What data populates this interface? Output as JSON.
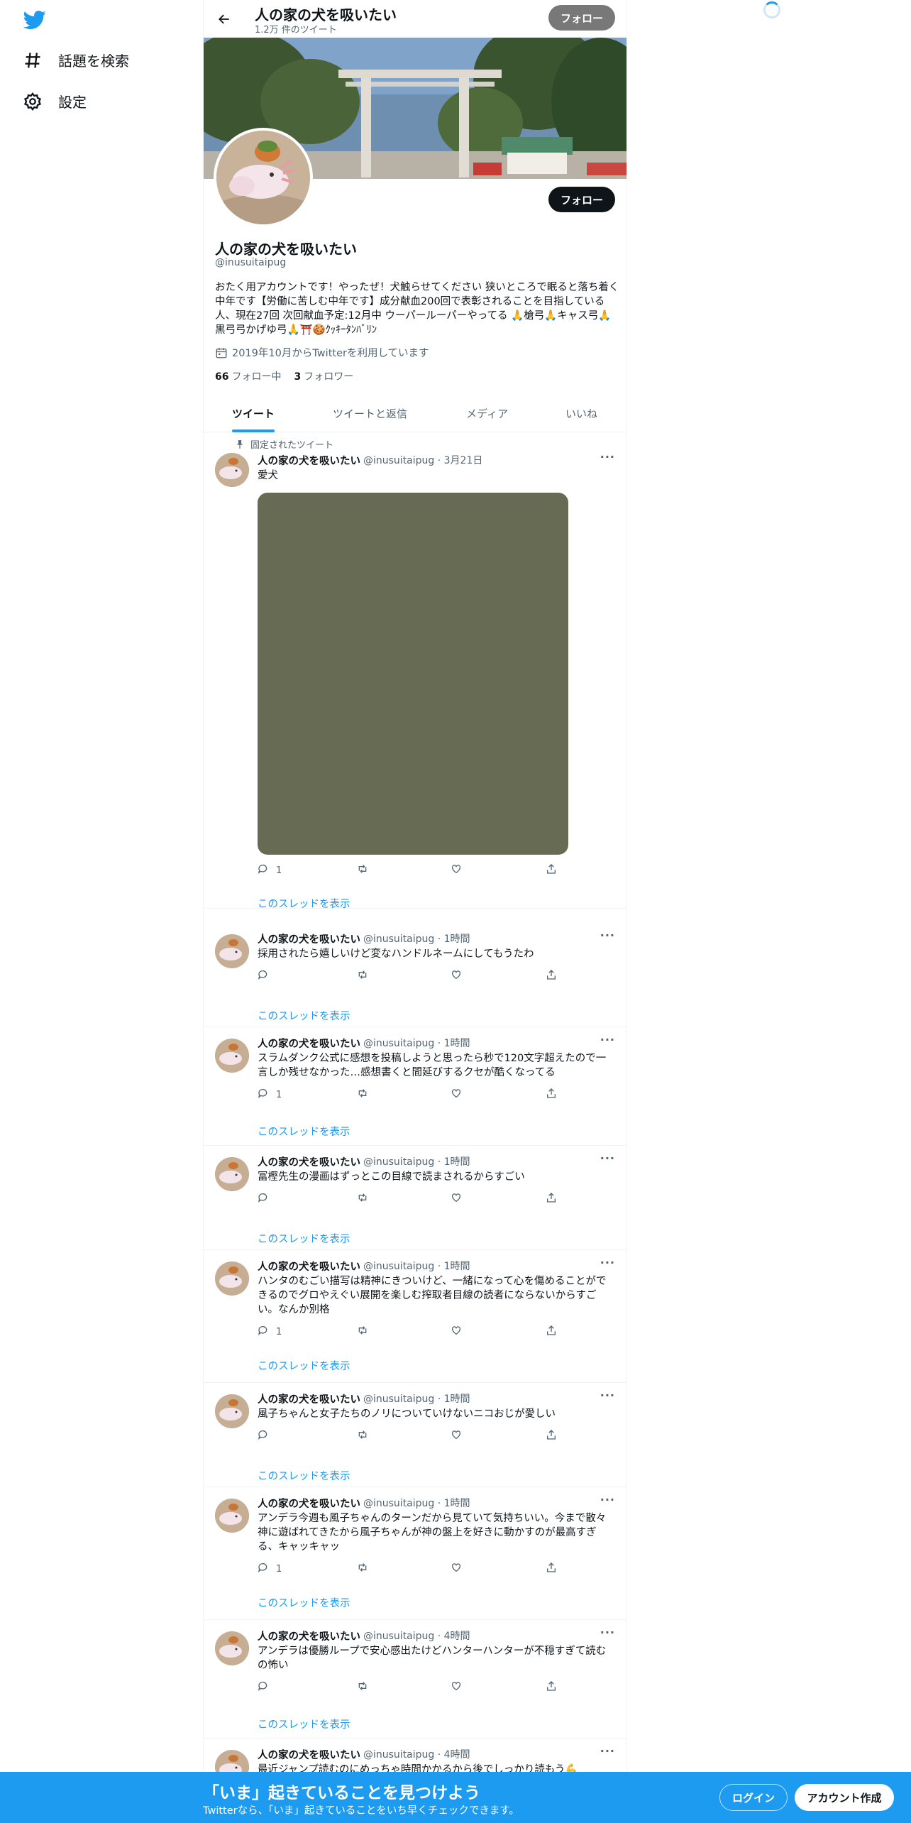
{
  "nav": {
    "items": [
      {
        "label": "話題を検索",
        "icon": "hashtag-icon"
      },
      {
        "label": "設定",
        "icon": "gear-icon"
      }
    ]
  },
  "header": {
    "title": "人の家の犬を吸いたい",
    "tweet_count": "1.2万 件のツイート",
    "follow_label": "フォロー"
  },
  "profile": {
    "name": "人の家の犬を吸いたい",
    "handle": "@inusuitaipug",
    "bio": "おたく用アカウントです！やったぜ！犬触らせてください 狭いところで眠ると落ち着く中年です【労働に苦しむ中年です】成分献血200回で表彰されることを目指している人、現在27回 次回献血予定:12月中 ウーパールーパーやってる 🙏槍弓🙏キャス弓🙏黒弓弓かげゆ弓🙏⛩️🍪ｸｯｷｰﾀﾝﾊﾞﾘﾝ",
    "joined": "2019年10月からTwitterを利用しています",
    "following_count": "66",
    "following_label": "フォロー中",
    "followers_count": "3",
    "followers_label": "フォロワー",
    "follow_label": "フォロー"
  },
  "tabs": [
    "ツイート",
    "ツイートと返信",
    "メディア",
    "いいね"
  ],
  "pinned_label": "固定されたツイート",
  "thread_label": "このスレッドを表示",
  "tweets": [
    {
      "name": "人の家の犬を吸いたい",
      "handle": "@inusuitaipug · 3月21日",
      "text": "愛犬",
      "replies": "1"
    },
    {
      "name": "人の家の犬を吸いたい",
      "handle": "@inusuitaipug · 1時間",
      "text": "採用されたら嬉しいけど変なハンドルネームにしてもうたわ",
      "replies": ""
    },
    {
      "name": "人の家の犬を吸いたい",
      "handle": "@inusuitaipug · 1時間",
      "text": "スラムダンク公式に感想を投稿しようと思ったら秒で120文字超えたので一言しか残せなかった…感想書くと間延びするクセが酷くなってる",
      "replies": "1"
    },
    {
      "name": "人の家の犬を吸いたい",
      "handle": "@inusuitaipug · 1時間",
      "text": "冨樫先生の漫画はずっとこの目線で読まされるからすごい",
      "replies": ""
    },
    {
      "name": "人の家の犬を吸いたい",
      "handle": "@inusuitaipug · 1時間",
      "text": "ハンタのむごい描写は精神にきついけど、一緒になって心を傷めることができるのでグロやえぐい展開を楽しむ搾取者目線の読者にならないからすごい。なんか別格",
      "replies": "1"
    },
    {
      "name": "人の家の犬を吸いたい",
      "handle": "@inusuitaipug · 1時間",
      "text": "風子ちゃんと女子たちのノリについていけないニコおじが愛しい",
      "replies": ""
    },
    {
      "name": "人の家の犬を吸いたい",
      "handle": "@inusuitaipug · 1時間",
      "text": "アンデラ今週も風子ちゃんのターンだから見ていて気持ちいい。今まで散々神に遊ばれてきたから風子ちゃんが神の盤上を好きに動かすのが最高すぎる、キャッキャッ",
      "replies": "1"
    },
    {
      "name": "人の家の犬を吸いたい",
      "handle": "@inusuitaipug · 4時間",
      "text": "アンデラは優勝ループで安心感出たけどハンターハンターが不穏すぎて読むの怖い",
      "replies": ""
    },
    {
      "name": "人の家の犬を吸いたい",
      "handle": "@inusuitaipug · 4時間",
      "text": "最近ジャンプ読むのにめっちゃ時間かかるから後でしっかり読もう💪",
      "replies": ""
    }
  ],
  "bottom": {
    "title": "「いま」起きていることを見つけよう",
    "subtitle": "Twitterなら、「いま」起きていることをいち早くチェックできます。",
    "login": "ログイン",
    "signup": "アカウント作成"
  },
  "colors": {
    "accent": "#1d9bf0",
    "text": "#0f1419",
    "muted": "#536471"
  }
}
